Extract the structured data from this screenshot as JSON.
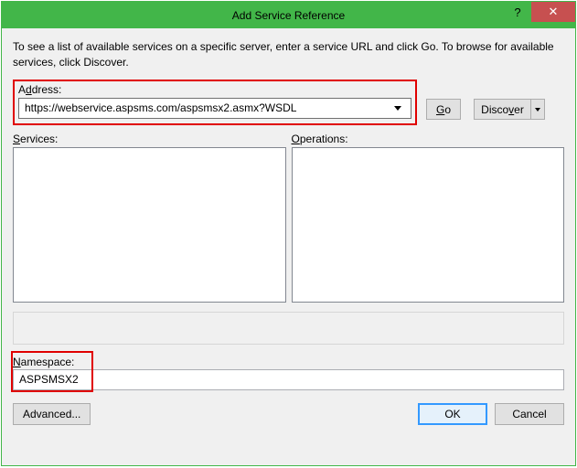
{
  "title": "Add Service Reference",
  "instruction": "To see a list of available services on a specific server, enter a service URL and click Go. To browse for available services, click Discover.",
  "address": {
    "label_pre": "A",
    "label_u": "d",
    "label_post": "dress:",
    "value": "https://webservice.aspsms.com/aspsmsx2.asmx?WSDL"
  },
  "buttons": {
    "go_u": "G",
    "go_post": "o",
    "discover": "Disco",
    "discover_u": "v",
    "discover_post": "er"
  },
  "lists": {
    "services_label_u": "S",
    "services_label_post": "ervices:",
    "operations_label_u": "O",
    "operations_label_post": "perations:"
  },
  "namespace": {
    "label_u": "N",
    "label_post": "amespace:",
    "value": "ASPSMSX2"
  },
  "footer": {
    "advanced": "Advanced...",
    "ok": "OK",
    "cancel": "Cancel"
  }
}
